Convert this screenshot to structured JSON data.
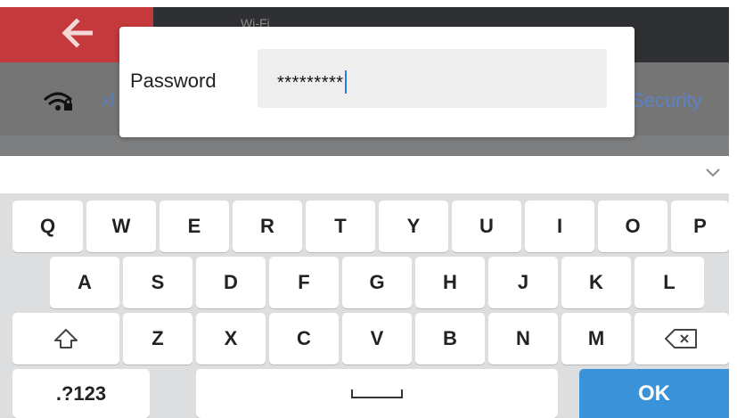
{
  "header": {
    "title": "Wi-Fi"
  },
  "network": {
    "ssid_fragment": "xl",
    "security_label": "Security"
  },
  "dialog": {
    "label": "Password",
    "value": "*********"
  },
  "keyboard": {
    "row1": [
      "Q",
      "W",
      "E",
      "R",
      "T",
      "Y",
      "U",
      "I",
      "O",
      "P"
    ],
    "row2": [
      "A",
      "S",
      "D",
      "F",
      "G",
      "H",
      "J",
      "K",
      "L"
    ],
    "row3": [
      "Z",
      "X",
      "C",
      "V",
      "B",
      "N",
      "M"
    ],
    "symbols_label": ".?123",
    "ok_label": "OK"
  },
  "colors": {
    "accent": "#3a92d8",
    "back_bg": "#c3393c",
    "ssid": "#5a7dbb"
  }
}
